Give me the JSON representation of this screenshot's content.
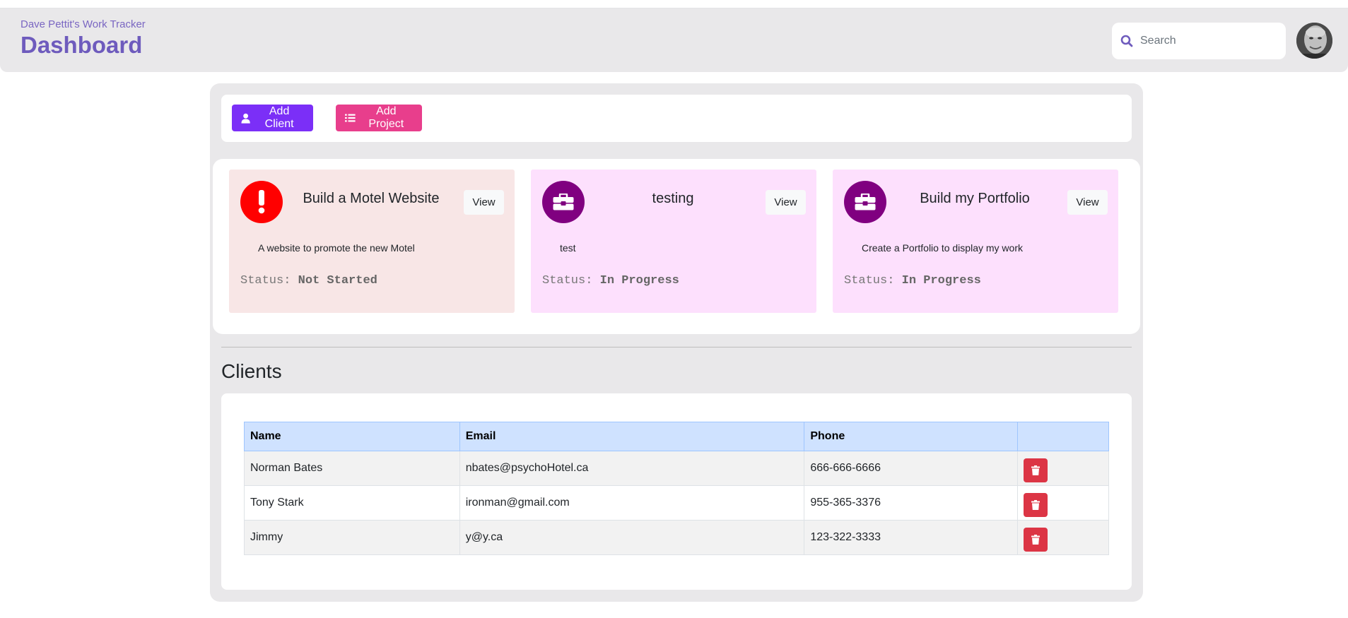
{
  "header": {
    "app_subtitle": "Dave Pettit's Work Tracker",
    "title": "Dashboard",
    "search": {
      "placeholder": "Search",
      "value": ""
    }
  },
  "toolbar": {
    "add_client_label": "Add Client",
    "add_project_label": "Add Project"
  },
  "projects": [
    {
      "title": "Build a Motel Website",
      "description": "A website to promote the new Motel",
      "status_label": "Status:",
      "status": "Not Started",
      "view_label": "View",
      "bg": "#f8e6e6",
      "icon": "exclamation-icon",
      "icon_color": "#ff0000"
    },
    {
      "title": "testing",
      "description": "test",
      "status_label": "Status:",
      "status": "In Progress",
      "view_label": "View",
      "bg": "#fde0fd",
      "icon": "toolbox-icon",
      "icon_color": "#800080"
    },
    {
      "title": "Build my Portfolio",
      "description": "Create a Portfolio to display my work",
      "status_label": "Status:",
      "status": "In Progress",
      "view_label": "View",
      "bg": "#fde0fd",
      "icon": "toolbox-icon",
      "icon_color": "#800080"
    }
  ],
  "clients": {
    "heading": "Clients",
    "columns": [
      "Name",
      "Email",
      "Phone",
      ""
    ],
    "rows": [
      {
        "name": "Norman Bates",
        "email": "nbates@psychoHotel.ca",
        "phone": "666-666-6666"
      },
      {
        "name": "Tony Stark",
        "email": "ironman@gmail.com",
        "phone": "955-365-3376"
      },
      {
        "name": "Jimmy",
        "email": "y@y.ca",
        "phone": "123-322-3333"
      }
    ]
  },
  "colors": {
    "header_bg": "#e9e8ea",
    "accent_purple": "#6e5bbd",
    "add_client": "#7b2ff7",
    "add_project": "#e83e8c",
    "delete": "#dc3545",
    "table_header": "#cfe2ff"
  }
}
